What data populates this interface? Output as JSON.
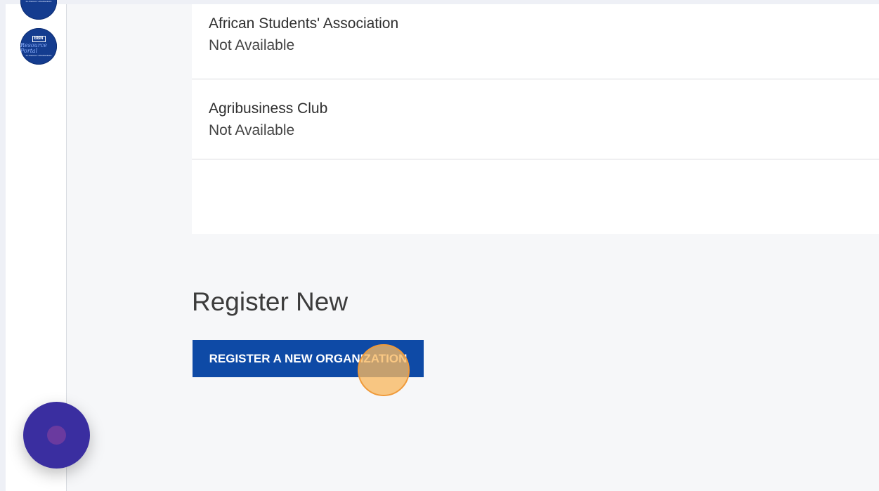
{
  "sidebar": {
    "badge": {
      "line1": "BBN",
      "line2": "Resource Portal",
      "line3": "ILLITERACY AWARENESS"
    }
  },
  "organizations": {
    "items": [
      {
        "name": "African Students' Association",
        "status": "Not Available"
      },
      {
        "name": "Agribusiness Club",
        "status": "Not Available"
      }
    ]
  },
  "register": {
    "heading": "Register New",
    "button_label": "REGISTER A NEW ORGANIZATION"
  },
  "colors": {
    "accent": "#0e4aa6",
    "badge": "#143c8f",
    "click_indicator": "#f8b860",
    "chat_launcher": "#3a2ea0"
  }
}
